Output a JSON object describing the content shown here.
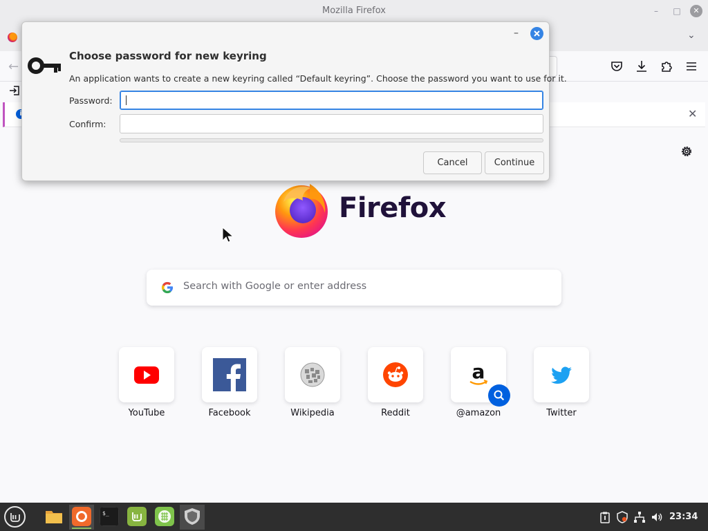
{
  "window": {
    "title": "Mozilla Firefox"
  },
  "dialog": {
    "title": "Choose password for new keyring",
    "description": "An application wants to create a new keyring called “Default keyring”. Choose the password you want to use for it.",
    "password_label": "Password:",
    "password_value": "",
    "confirm_label": "Confirm:",
    "confirm_value": "",
    "cancel_label": "Cancel",
    "continue_label": "Continue"
  },
  "home": {
    "brand": "Firefox",
    "search_placeholder": "Search with Google or enter address",
    "shortcuts": [
      {
        "label": "YouTube",
        "icon": "youtube-icon"
      },
      {
        "label": "Facebook",
        "icon": "facebook-icon"
      },
      {
        "label": "Wikipedia",
        "icon": "wikipedia-icon"
      },
      {
        "label": "Reddit",
        "icon": "reddit-icon"
      },
      {
        "label": "@amazon",
        "icon": "amazon-icon"
      },
      {
        "label": "Twitter",
        "icon": "twitter-icon"
      }
    ]
  },
  "taskbar": {
    "clock": "23:34",
    "apps": [
      "files-icon",
      "firefox-icon",
      "terminal-icon",
      "mint-update-icon",
      "calculator-icon",
      "shield-icon"
    ]
  },
  "colors": {
    "accent": "#3584e4",
    "firefox_blue": "#0060df",
    "taskbar": "#2e2e2e"
  }
}
